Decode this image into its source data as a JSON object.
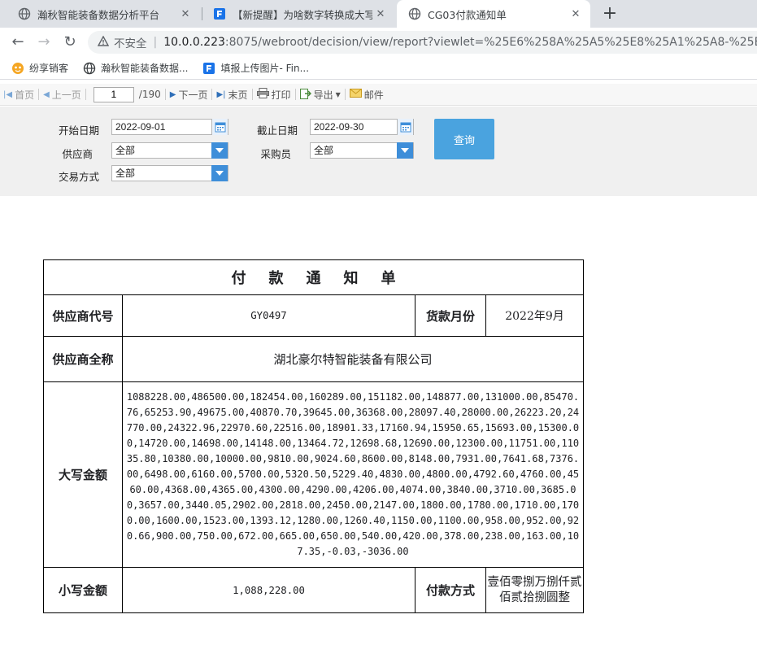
{
  "browser": {
    "tabs": [
      {
        "title": "瀚秋智能装备数据分析平台",
        "active": false
      },
      {
        "title": "【新提醒】为啥数字转换成大写中",
        "active": false
      },
      {
        "title": "CG03付款通知单",
        "active": true
      }
    ],
    "new_tab": "+",
    "address": {
      "security_label": "不安全",
      "url_host": "10.0.0.223",
      "url_rest": ":8075/webroot/decision/view/report?viewlet=%25E6%258A%25A5%25E8%25A1%25A8-%25E4%25"
    },
    "bookmarks": [
      {
        "label": "纷享销客"
      },
      {
        "label": "瀚秋智能装备数据..."
      },
      {
        "label": "填报上传图片- Fin..."
      }
    ]
  },
  "toolbar": {
    "first": "首页",
    "prev": "上一页",
    "page": "1",
    "total": "/190",
    "next": "下一页",
    "last": "末页",
    "print": "打印",
    "export": "导出",
    "mail": "邮件"
  },
  "params": {
    "start_label": "开始日期",
    "start_value": "2022-09-01",
    "end_label": "截止日期",
    "end_value": "2022-09-30",
    "supplier_label": "供应商",
    "supplier_value": "全部",
    "buyer_label": "采购员",
    "buyer_value": "全部",
    "trade_label": "交易方式",
    "trade_value": "全部",
    "query_label": "查询"
  },
  "report": {
    "title": "付款通知单",
    "supplier_code_label": "供应商代号",
    "supplier_code": "GY0497",
    "month_label": "货款月份",
    "month": "2022年9月",
    "supplier_name_label": "供应商全称",
    "supplier_name": "湖北豪尔特智能装备有限公司",
    "upper_amount_label": "大写金额",
    "upper_amount_value": "1088228.00,486500.00,182454.00,160289.00,151182.00,148877.00,131000.00,85470.76,65253.90,49675.00,40870.70,39645.00,36368.00,28097.40,28000.00,26223.20,24770.00,24322.96,22970.60,22516.00,18901.33,17160.94,15950.65,15693.00,15300.00,14720.00,14698.00,14148.00,13464.72,12698.68,12690.00,12300.00,11751.00,11035.80,10380.00,10000.00,9810.00,9024.60,8600.00,8148.00,7931.00,7641.68,7376.00,6498.00,6160.00,5700.00,5320.50,5229.40,4830.00,4800.00,4792.60,4760.00,4560.00,4368.00,4365.00,4300.00,4290.00,4206.00,4074.00,3840.00,3710.00,3685.00,3657.00,3440.05,2902.00,2818.00,2450.00,2147.00,1800.00,1780.00,1710.00,1700.00,1600.00,1523.00,1393.12,1280.00,1260.40,1150.00,1100.00,958.00,952.00,920.66,900.00,750.00,672.00,665.00,650.00,540.00,420.00,378.00,238.00,163.00,107.35,-0.03,-3036.00",
    "lower_amount_label": "小写金额",
    "lower_amount_value": "1,088,228.00",
    "pay_method_label": "付款方式",
    "pay_method_value": "壹佰零捌万捌仟贰佰贰拾捌圆整"
  }
}
